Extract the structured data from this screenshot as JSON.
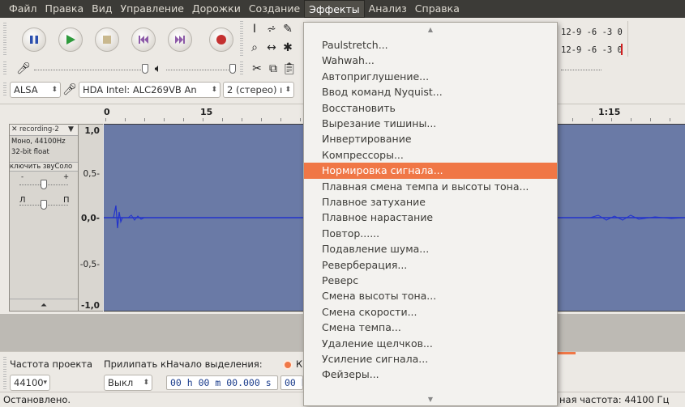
{
  "menubar": {
    "items": [
      "Файл",
      "Правка",
      "Вид",
      "Управление",
      "Дорожки",
      "Создание",
      "Эффекты",
      "Анализ",
      "Справка"
    ],
    "active": "Эффекты"
  },
  "colors": {
    "menubar_bg": "#3c3b37",
    "highlight": "#f07746",
    "waveform": "#2233cc",
    "wave_bg": "#6a7aa6",
    "digits": "#1a3c8c"
  },
  "transport": {
    "icons": [
      "pause-icon",
      "play-icon",
      "stop-icon",
      "skip-start-icon",
      "skip-end-icon",
      "record-icon"
    ]
  },
  "meter": {
    "scale_top": "12-9 -6 -3 0",
    "scale_bottom": "12-9 -6 -3 0"
  },
  "devices": {
    "host": "ALSA",
    "input_device": "HDA Intel: ALC269VB An",
    "channels": "2 (стерео) ı"
  },
  "ruler": {
    "labels": [
      "0",
      "15",
      "1:15"
    ]
  },
  "track": {
    "name": "recording-2",
    "info_line1": "Моно, 44100Hz",
    "info_line2": "32-bit float",
    "mute_solo": "ключить звуСоло",
    "gain_minus": "-",
    "gain_plus": "+",
    "pan_left": "Л",
    "pan_right": "П",
    "scale": [
      "1,0",
      "0,5-",
      "0,0-",
      "-0,5-",
      "-1,0"
    ]
  },
  "selection_bar": {
    "rate_label": "Частота проекта",
    "snap_label": "Прилипать к:",
    "start_label": "Начало выделения:",
    "radio_label": "К",
    "rate_value": "44100",
    "snap_value": "Выкл",
    "start_value": "00 h 00 m 00.000 s",
    "second_value": "00 h"
  },
  "status": {
    "left": "Остановлено.",
    "right": "ная частота: 44100 Гц"
  },
  "effects_menu": {
    "items": [
      "Paulstretch...",
      "Wahwah...",
      "Автоприглушение...",
      "Ввод команд Nyquist...",
      "Восстановить",
      "Вырезание тишины...",
      "Инвертирование",
      "Компрессоры...",
      "Нормировка сигнала...",
      "Плавная смена темпа и высоты тона...",
      "Плавное затухание",
      "Плавное нарастание",
      "Повтор......",
      "Подавление шума...",
      "Реверберация...",
      "Реверс",
      "Смена высоты тона...",
      "Смена скорости...",
      "Смена темпа...",
      "Удаление щелчков...",
      "Усиление сигнала...",
      "Фейзеры..."
    ],
    "highlighted": "Нормировка сигнала..."
  }
}
